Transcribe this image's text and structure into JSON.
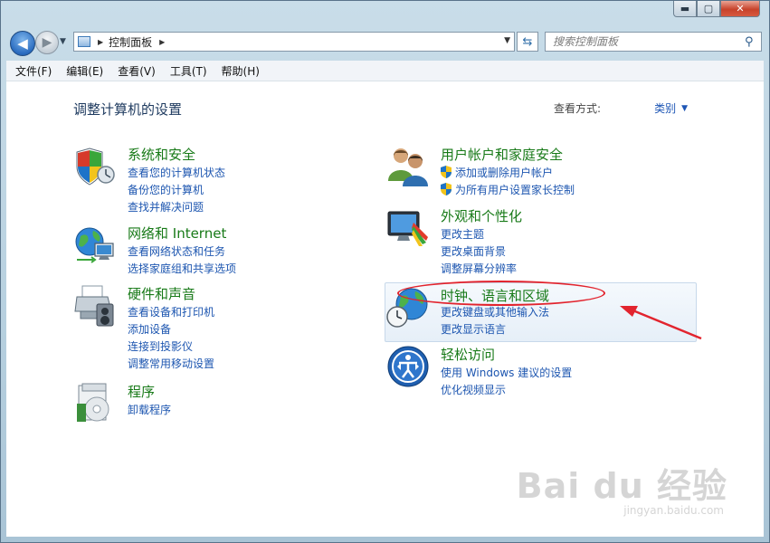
{
  "window": {
    "caption_buttons": [
      "minimize",
      "maximize",
      "close"
    ],
    "min_glyph": "▬",
    "max_glyph": "▢",
    "close_glyph": "✕"
  },
  "address": {
    "breadcrumb": "控制面板",
    "search_placeholder": "搜索控制面板"
  },
  "menu": [
    "文件(F)",
    "编辑(E)",
    "查看(V)",
    "工具(T)",
    "帮助(H)"
  ],
  "page": {
    "title": "调整计算机的设置",
    "view_by_label": "查看方式:",
    "view_by_value": "类别"
  },
  "categories": {
    "system": {
      "title": "系统和安全",
      "links": [
        "查看您的计算机状态",
        "备份您的计算机",
        "查找并解决问题"
      ]
    },
    "network": {
      "title": "网络和 Internet",
      "links": [
        "查看网络状态和任务",
        "选择家庭组和共享选项"
      ]
    },
    "hardware": {
      "title": "硬件和声音",
      "links": [
        "查看设备和打印机",
        "添加设备",
        "连接到投影仪",
        "调整常用移动设置"
      ]
    },
    "programs": {
      "title": "程序",
      "links": [
        "卸载程序"
      ]
    },
    "users": {
      "title": "用户帐户和家庭安全",
      "links": [
        "添加或删除用户帐户",
        "为所有用户设置家长控制"
      ]
    },
    "appearance": {
      "title": "外观和个性化",
      "links": [
        "更改主题",
        "更改桌面背景",
        "调整屏幕分辨率"
      ]
    },
    "clock": {
      "title": "时钟、语言和区域",
      "links": [
        "更改键盘或其他输入法",
        "更改显示语言"
      ]
    },
    "ease": {
      "title": "轻松访问",
      "links": [
        "使用 Windows 建议的设置",
        "优化视频显示"
      ]
    }
  },
  "watermark": {
    "brand": "Bai du 经验",
    "url": "jingyan.baidu.com"
  },
  "colors": {
    "category_title": "#187a18",
    "link": "#1d56b0",
    "annotation": "#e2242e"
  }
}
